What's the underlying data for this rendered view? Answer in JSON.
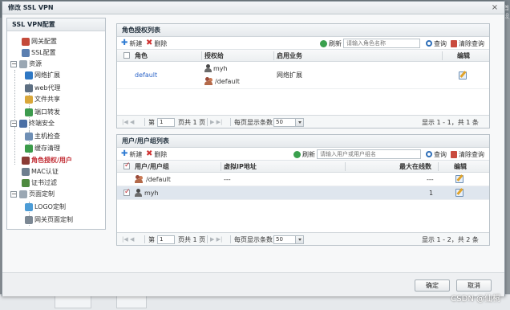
{
  "dialog": {
    "title": "修改 SSL VPN",
    "close_glyph": "×"
  },
  "background": {
    "edge_text": "首设"
  },
  "sidebar": {
    "title": "SSL VPN配置",
    "items": [
      {
        "label": "网关配置",
        "icon": "gateway-config-icon",
        "color": "#c44a3a"
      },
      {
        "label": "SSL配置",
        "icon": "ssl-config-icon",
        "color": "#5b7fb0"
      },
      {
        "label": "资源",
        "icon": "resource-folder-icon",
        "color": "#9aa7b3",
        "toggle": "−"
      },
      {
        "label": "网络扩展",
        "icon": "network-extend-icon",
        "color": "#2f78c4"
      },
      {
        "label": "web代理",
        "icon": "web-proxy-icon",
        "color": "#5d6f82"
      },
      {
        "label": "文件共享",
        "icon": "file-share-icon",
        "color": "#d9a73a"
      },
      {
        "label": "端口转发",
        "icon": "port-forward-icon",
        "color": "#3d9b4e"
      },
      {
        "label": "终端安全",
        "icon": "terminal-security-icon",
        "color": "#4a6fa5",
        "toggle": "−"
      },
      {
        "label": "主机检查",
        "icon": "host-check-icon",
        "color": "#6f8fb5"
      },
      {
        "label": "缓存清理",
        "icon": "cache-clean-icon",
        "color": "#3b9b4a"
      },
      {
        "label": "角色授权/用户",
        "icon": "role-auth-icon",
        "color": "#8a3b35",
        "active": true
      },
      {
        "label": "MAC认证",
        "icon": "mac-auth-icon",
        "color": "#6e7f8f"
      },
      {
        "label": "证书过滤",
        "icon": "cert-filter-icon",
        "color": "#4e8a3f"
      },
      {
        "label": "页面定制",
        "icon": "page-custom-icon",
        "color": "#9aa7b3",
        "toggle": "−"
      },
      {
        "label": "LOGO定制",
        "icon": "logo-custom-icon",
        "color": "#4c9cd6"
      },
      {
        "label": "网关页面定制",
        "icon": "gateway-page-icon",
        "color": "#7c8894"
      }
    ]
  },
  "role_panel": {
    "title": "角色授权列表",
    "add_label": "新建",
    "delete_label": "删除",
    "refresh_label": "刷新",
    "search_placeholder": "请输入角色名称",
    "query_label": "查询",
    "clear_label": "清除查询",
    "columns": [
      "角色",
      "授权给",
      "启用业务",
      "编辑"
    ],
    "rows": [
      {
        "role": "default",
        "grant_user": "myh",
        "grant_group": "/default",
        "service": "网络扩展"
      }
    ],
    "pager": {
      "page_prefix": "第",
      "page_value": "1",
      "page_suffix": "页共 1 页",
      "per_page_label": "每页显示条数",
      "per_page_value": "50",
      "summary": "显示 1 - 1，共 1 条"
    }
  },
  "user_panel": {
    "title": "用户/用户组列表",
    "add_label": "新建",
    "delete_label": "删除",
    "refresh_label": "刷新",
    "search_placeholder": "请输入用户或用户组名",
    "query_label": "查询",
    "clear_label": "清除查询",
    "columns": [
      "用户/用户组",
      "虚拟IP地址",
      "最大在线数",
      "编辑"
    ],
    "rows": [
      {
        "name": "/default",
        "type": "group",
        "ip": "---",
        "max_online": "---",
        "checked": false
      },
      {
        "name": "myh",
        "type": "user",
        "ip": "",
        "max_online": "1",
        "checked": true
      }
    ],
    "pager": {
      "page_prefix": "第",
      "page_value": "1",
      "page_suffix": "页共 1 页",
      "per_page_label": "每页显示条数",
      "per_page_value": "50",
      "summary": "显示 1 - 2，共 2 条"
    }
  },
  "footer": {
    "ok_label": "确定",
    "cancel_label": "取消"
  },
  "watermark": "CSDN @仙桐",
  "colors": {
    "accent_red": "#c0282f",
    "link_blue": "#2a63c7",
    "selected_row": "#dfe6ee"
  }
}
